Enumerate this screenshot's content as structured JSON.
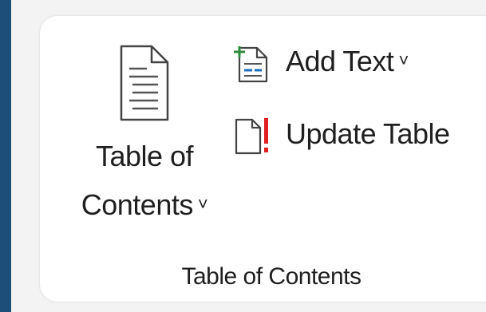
{
  "group": {
    "label": "Table of Contents"
  },
  "toc_button": {
    "label_line1": "Table of",
    "label_line2": "Contents",
    "chevron": "˅",
    "icon": "document-lines-icon"
  },
  "add_text": {
    "label": "Add Text",
    "chevron": "˅",
    "icon": "add-text-icon",
    "accent_color": "#2e8b3a",
    "line_color": "#1f6fc1"
  },
  "update_table": {
    "label": "Update Table",
    "icon": "update-table-icon",
    "accent_color": "#e02020"
  },
  "colors": {
    "left_bar": "#1d4e7a",
    "background": "#f3f3f3",
    "panel": "#ffffff"
  }
}
